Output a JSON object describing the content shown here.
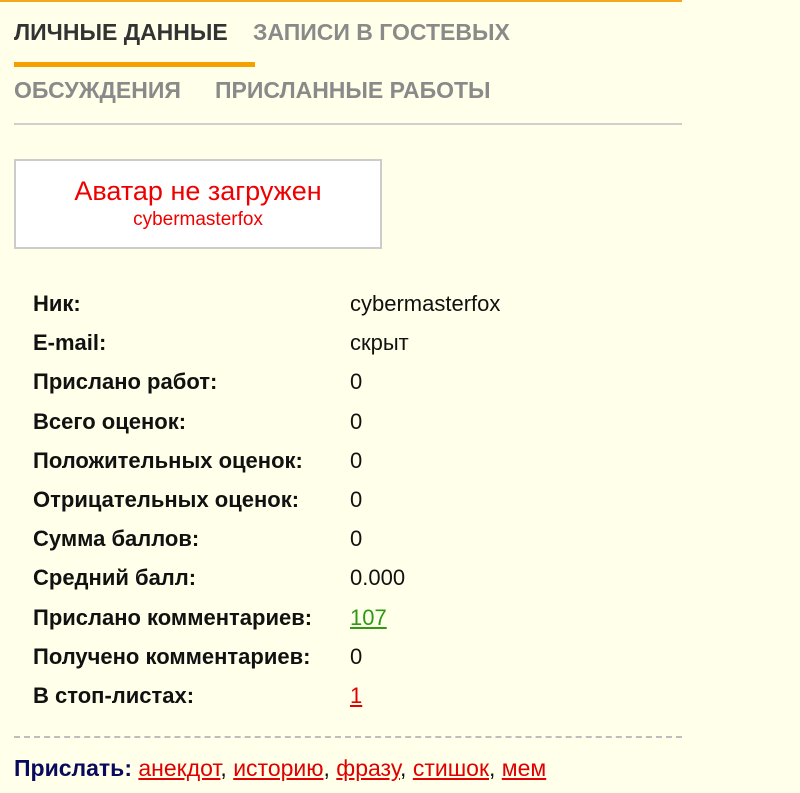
{
  "tabs": {
    "personal": "ЛИЧНЫЕ ДАННЫЕ",
    "guestbook": "ЗАПИСИ В ГОСТЕВЫХ",
    "discussions": "ОБСУЖДЕНИЯ",
    "works": "ПРИСЛАННЫЕ РАБОТЫ",
    "active": "personal"
  },
  "avatar": {
    "title": "Аватар не загружен",
    "username": "cybermasterfox"
  },
  "profile": [
    {
      "label": "Ник:",
      "value": "cybermasterfox"
    },
    {
      "label": "E-mail:",
      "value": "скрыт"
    },
    {
      "label": "Прислано работ:",
      "value": "0"
    },
    {
      "label": "Всего оценок:",
      "value": "0"
    },
    {
      "label": "Положительных оценок:",
      "value": "0"
    },
    {
      "label": "Отрицательных оценок:",
      "value": "0"
    },
    {
      "label": "Сумма баллов:",
      "value": "0"
    },
    {
      "label": "Средний балл:",
      "value": "0.000"
    },
    {
      "label": "Прислано комментариев:",
      "value": "107"
    },
    {
      "label": "Получено комментариев:",
      "value": "0"
    },
    {
      "label": "В стоп-листах:",
      "value": "1"
    }
  ],
  "send": {
    "label": "Прислать:",
    "links": [
      "анекдот",
      "историю",
      "фразу",
      "стишок",
      "мем"
    ],
    "separator": ","
  },
  "colors": {
    "accent": "#f5a000",
    "background": "#ffffea",
    "link_red": "#e00000",
    "link_green": "#2c9a12",
    "send_label": "#0a0a5c"
  }
}
